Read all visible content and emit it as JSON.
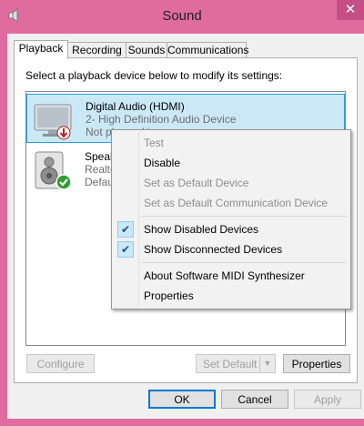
{
  "window": {
    "title": "Sound",
    "close_label": "✕"
  },
  "tabs": [
    {
      "label": "Playback"
    },
    {
      "label": "Recording"
    },
    {
      "label": "Sounds"
    },
    {
      "label": "Communications"
    }
  ],
  "instruction": "Select a playback device below to modify its settings:",
  "devices": [
    {
      "name": "Digital Audio (HDMI)",
      "line2": "2- High Definition Audio Device",
      "line3": "Not plugged in",
      "icon": "monitor-icon",
      "status": "not-plugged-in"
    },
    {
      "name": "Speak",
      "line2": "Realte",
      "line3": "Defau",
      "icon": "speaker-icon",
      "status": "default"
    }
  ],
  "context_menu": {
    "items": [
      {
        "label": "Test",
        "enabled": false,
        "checked": false
      },
      {
        "label": "Disable",
        "enabled": true,
        "checked": false
      },
      {
        "label": "Set as Default Device",
        "enabled": false,
        "checked": false
      },
      {
        "label": "Set as Default Communication Device",
        "enabled": false,
        "checked": false
      },
      {
        "label": "Show Disabled Devices",
        "enabled": true,
        "checked": true
      },
      {
        "label": "Show Disconnected Devices",
        "enabled": true,
        "checked": true
      },
      {
        "label": "About Software MIDI Synthesizer",
        "enabled": true,
        "checked": false
      },
      {
        "label": "Properties",
        "enabled": true,
        "checked": false
      }
    ]
  },
  "buttons": {
    "configure": "Configure",
    "set_default": "Set Default",
    "properties": "Properties",
    "ok": "OK",
    "cancel": "Cancel",
    "apply": "Apply"
  },
  "colors": {
    "frame": "#e06c9f",
    "selection": "#cbe8f6",
    "selection_border": "#26a0da"
  }
}
